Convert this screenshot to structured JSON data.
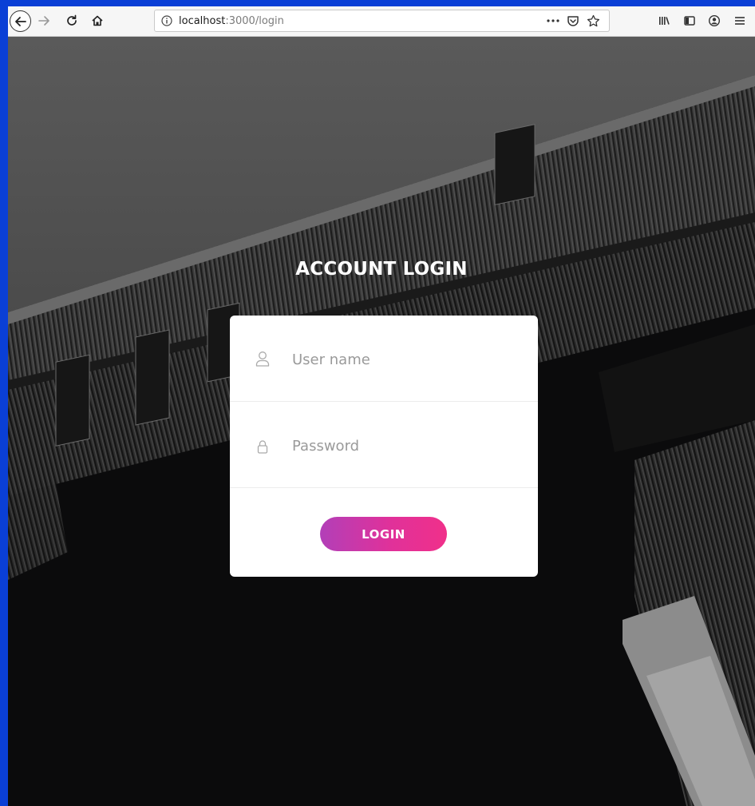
{
  "browser": {
    "url_host": "localhost",
    "url_path": ":3000/login",
    "icons": [
      "back-icon",
      "forward-icon",
      "reload-icon",
      "home-icon",
      "info-icon",
      "more-icon",
      "pocket-icon",
      "bookmark-star-icon",
      "library-icon",
      "sidebar-icon",
      "account-icon",
      "menu-icon"
    ]
  },
  "login": {
    "title": "ACCOUNT LOGIN",
    "username_placeholder": "User name",
    "password_placeholder": "Password",
    "submit_label": "LOGIN"
  },
  "colors": {
    "desktop_bg": "#0a3fd6",
    "button_gradient_start": "#b23fb8",
    "button_gradient_end": "#f0308a"
  }
}
